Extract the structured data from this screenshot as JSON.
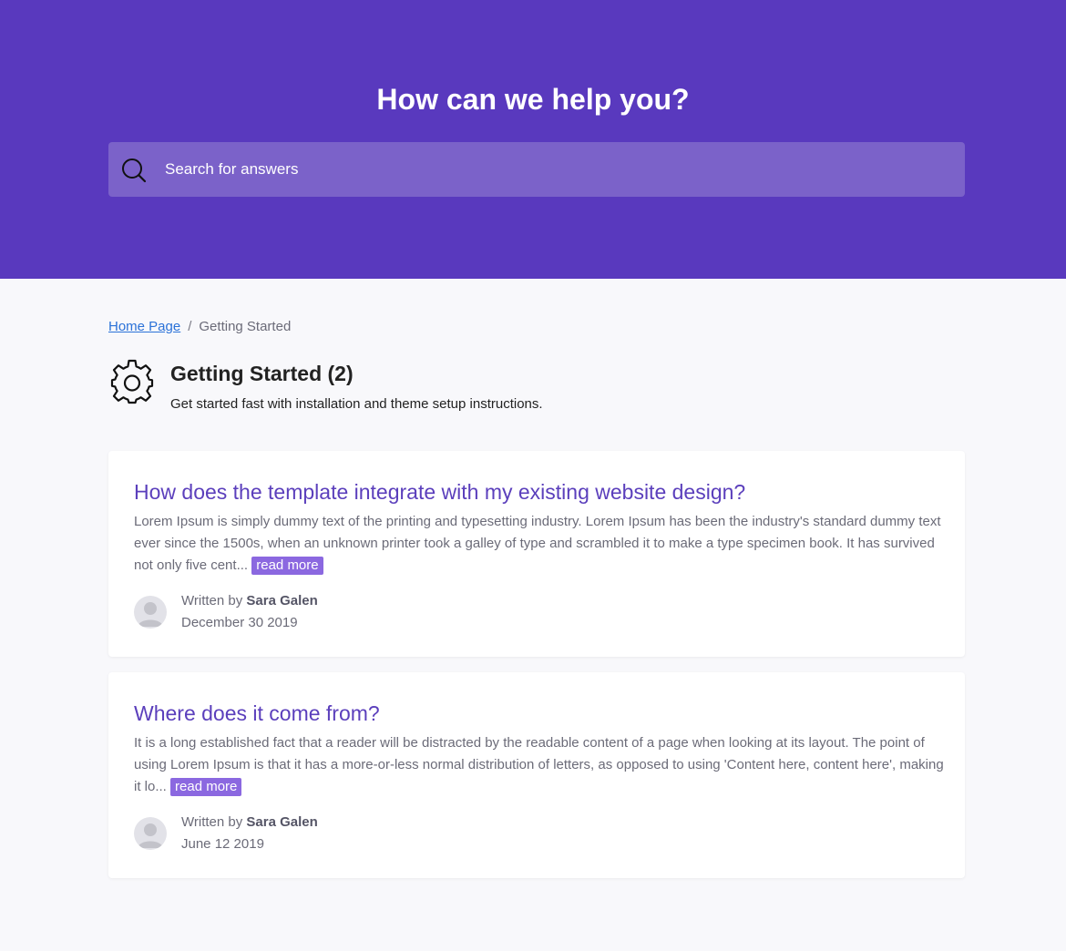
{
  "hero": {
    "title": "How can we help you?",
    "search_placeholder": "Search for answers",
    "icon": "search-icon"
  },
  "breadcrumb": {
    "home": "Home Page",
    "separator": "/",
    "current": "Getting Started"
  },
  "category": {
    "icon": "gear-icon",
    "title": "Getting Started (2)",
    "description": "Get started fast with installation and theme setup instructions."
  },
  "articles": [
    {
      "title": "How does the template integrate with my existing website design?",
      "excerpt": "Lorem Ipsum is simply dummy text of the printing and typesetting industry. Lorem Ipsum has been the industry's standard dummy text ever since the 1500s, when an unknown printer took a galley of type and scrambled it to make a type specimen book. It has survived not only five cent...",
      "read_more": "read more",
      "written_by": "Written by",
      "author": "Sara Galen",
      "date": "December 30 2019"
    },
    {
      "title": "Where does it come from?",
      "excerpt": "It is a long established fact that a reader will be distracted by the readable content of a page when looking at its layout. The point of using Lorem Ipsum is that it has a more-or-less normal distribution of letters, as opposed to using 'Content here, content here', making it lo...",
      "read_more": "read more",
      "written_by": "Written by",
      "author": "Sara Galen",
      "date": "June 12 2019"
    }
  ],
  "colors": {
    "hero_bg": "#5939be",
    "search_bg": "#7b62c9",
    "accent": "#5b3fbc",
    "read_more_bg": "#8b68e0",
    "link": "#2b72d8",
    "page_bg": "#f8f8fb"
  }
}
